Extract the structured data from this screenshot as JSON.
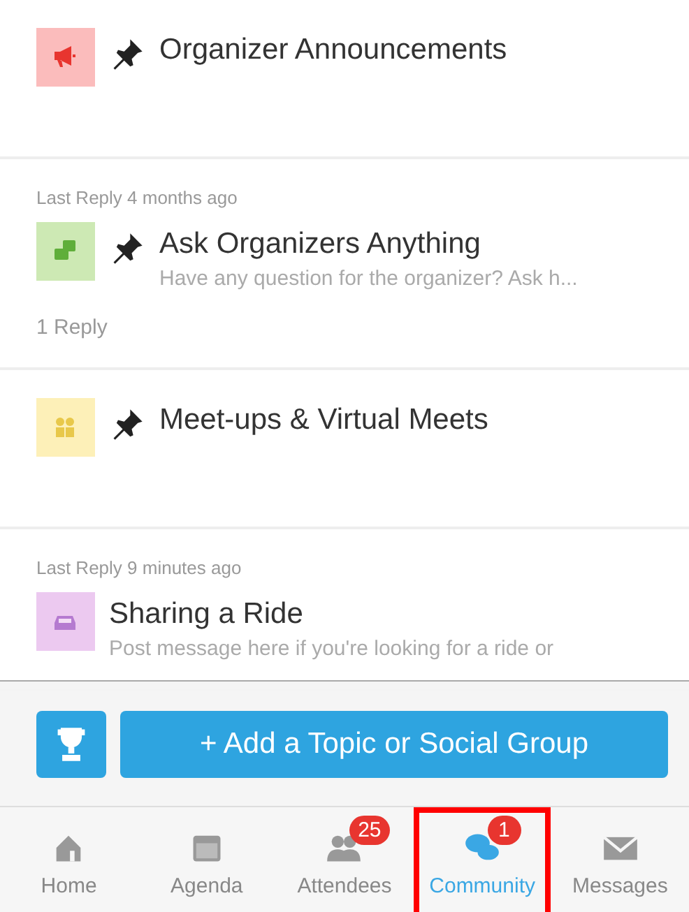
{
  "topics": [
    {
      "kind": "megaphone",
      "color": "#fbbcbc",
      "pinned": true,
      "title": "Organizer Announcements"
    },
    {
      "kind": "chat",
      "color": "#cde9b4",
      "pinned": true,
      "last_reply": "Last Reply 4 months ago",
      "title": "Ask Organizers Anything",
      "subtitle": "Have any question for the organizer? Ask h...",
      "replies": "1 Reply"
    },
    {
      "kind": "people",
      "color": "#fdf0b8",
      "pinned": true,
      "title": "Meet-ups & Virtual Meets"
    },
    {
      "kind": "car",
      "color": "#ecc9f0",
      "pinned": false,
      "last_reply": "Last Reply 9 minutes ago",
      "title": "Sharing a Ride",
      "subtitle": "Post message here if you're looking for a ride or"
    }
  ],
  "add_button": {
    "label": "+ Add a Topic or Social Group"
  },
  "tabs": [
    {
      "kind": "home",
      "label": "Home",
      "selected": false,
      "highlighted": false
    },
    {
      "kind": "calendar",
      "label": "Agenda",
      "selected": false,
      "highlighted": false
    },
    {
      "kind": "people",
      "label": "Attendees",
      "selected": false,
      "highlighted": false,
      "badge": "25"
    },
    {
      "kind": "chat",
      "label": "Community",
      "selected": true,
      "highlighted": true,
      "badge": "1"
    },
    {
      "kind": "mail",
      "label": "Messages",
      "selected": false,
      "highlighted": false
    }
  ]
}
